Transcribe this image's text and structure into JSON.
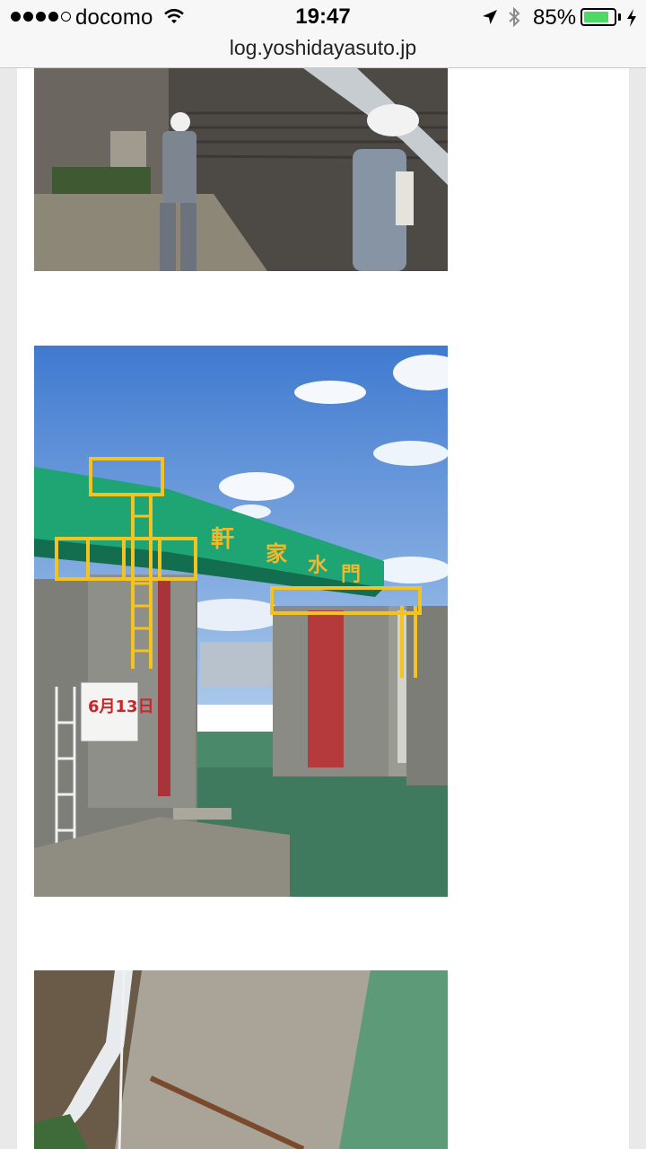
{
  "status_bar": {
    "carrier": "docomo",
    "time": "19:47",
    "battery_percent": "85%",
    "battery_level": 0.85,
    "icons": [
      "signal-dots",
      "wifi-icon",
      "location-arrow-icon",
      "bluetooth-icon",
      "battery-icon",
      "charging-bolt-icon"
    ]
  },
  "browser": {
    "url": "log.yoshidayasuto.jp"
  },
  "article": {
    "photos": [
      {
        "subject": "two workers in hard hats beside concrete wall"
      },
      {
        "subject": "green gate bridge over canal water with yellow ladders"
      },
      {
        "subject": "overhead view of concrete dock and pipe by water"
      }
    ],
    "sign_text": {
      "date": "6月13日",
      "gate_name_1": "軒",
      "gate_name_2": "家",
      "gate_name_3": "水",
      "gate_name_4": "門"
    }
  },
  "colors": {
    "status_bar_bg": "#f7f7f7",
    "page_bg": "#ffffff",
    "side_bg": "#e9e9e9",
    "battery_green": "#4cd964",
    "gate_green": "#1fa574",
    "sky_blue": "#4f86d6",
    "water_green": "#3f7a5e"
  }
}
